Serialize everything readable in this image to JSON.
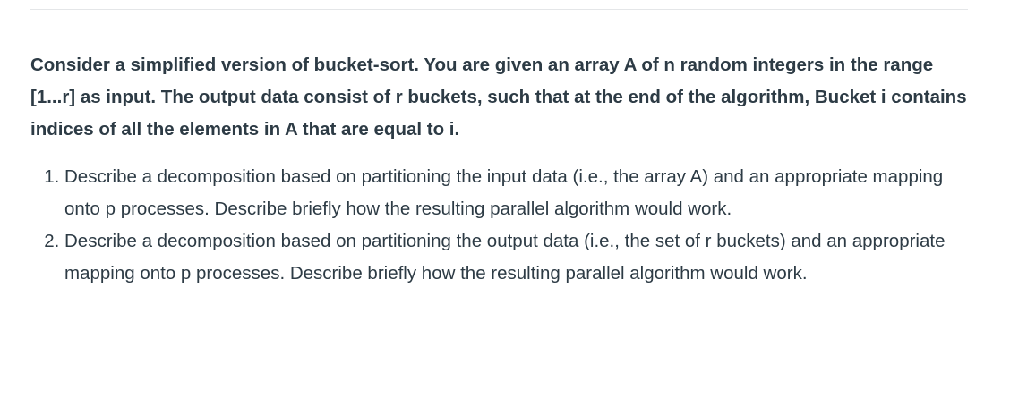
{
  "question": {
    "stem": "Consider a simplified version of bucket-sort. You are given an array A of n random integers in the range [1...r] as input. The output data consist of r buckets, such that at the end of the algorithm, Bucket i contains indices of all the elements in A that are equal to i.",
    "items": [
      "Describe a decomposition based on partitioning the input data (i.e., the array A) and an appropriate mapping onto p processes. Describe briefly how the resulting parallel algorithm would work.",
      "Describe a decomposition based on partitioning the output data (i.e., the set of r buckets) and an appropriate mapping onto p processes. Describe briefly how the resulting parallel algorithm would work."
    ]
  }
}
